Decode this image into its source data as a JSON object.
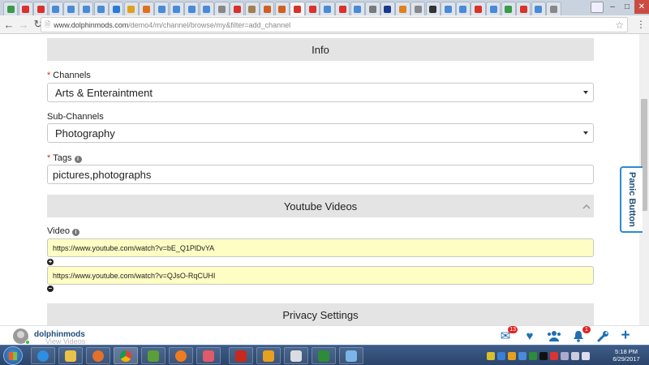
{
  "browser": {
    "tab_count": 37,
    "url_host": "www.dolphinmods.com",
    "url_path": "/demo4/m/channel/browse/my&filter=add_channel"
  },
  "form": {
    "info_header": "Info",
    "channels": {
      "label": "Channels",
      "value": "Arts & Enteraintment"
    },
    "subchannels": {
      "label": "Sub-Channels",
      "value": "Photography"
    },
    "tags": {
      "label": "Tags",
      "value": "pictures,photographs"
    },
    "youtube_header": "Youtube Videos",
    "video_label": "Video",
    "videos": [
      "https://www.youtube.com/watch?v=bE_Q1PlDvYA",
      "https://www.youtube.com/watch?v=QJsO-RqCUHI"
    ],
    "privacy_header": "Privacy Settings"
  },
  "panic_button": "Panic Button",
  "app_bar": {
    "username": "dolphinmods",
    "subtext": "View Videos",
    "mail_badge": "13",
    "notification_badge": "1",
    "icons": [
      "mail-icon",
      "heart-icon",
      "friends-icon",
      "bell-icon",
      "wrench-icon",
      "plus-icon"
    ]
  },
  "taskbar": {
    "time": "5:18 PM",
    "date": "6/29/2017"
  }
}
